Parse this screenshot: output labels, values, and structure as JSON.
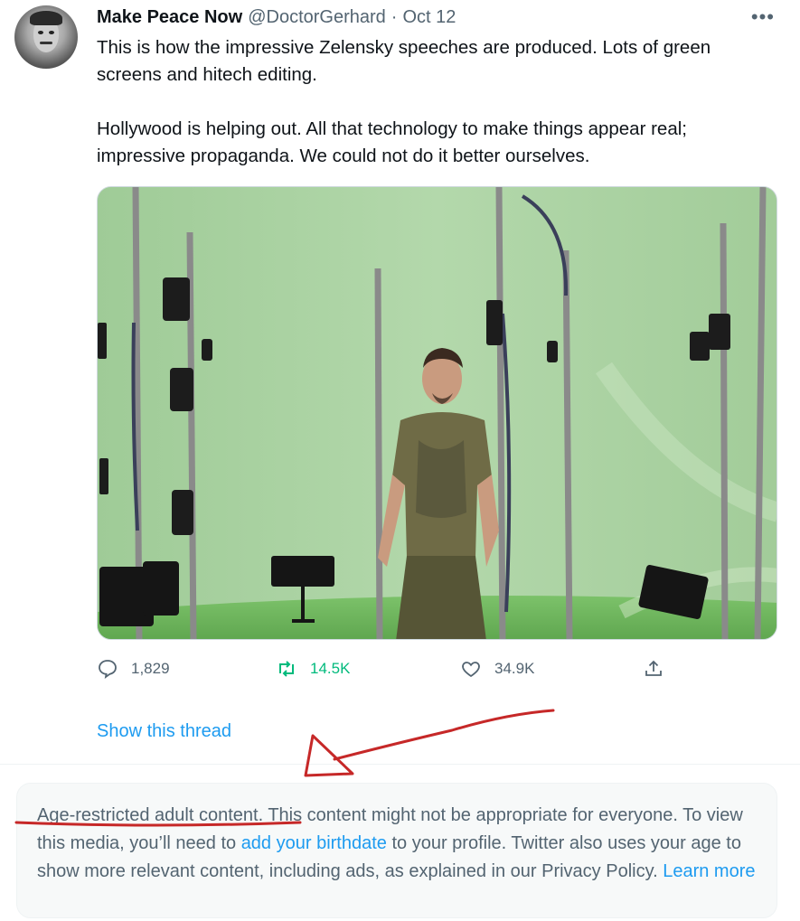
{
  "tweet": {
    "display_name": "Make Peace Now",
    "handle": "@DoctorGerhard",
    "separator": "·",
    "date": "Oct 12",
    "more_icon": "more-icon",
    "paragraph_1": "This is how the impressive Zelensky speeches are produced. Lots of green screens and hitech editing.",
    "paragraph_2": "Hollywood is helping out. All that technology to make things appear real; impressive propaganda. We could not do it better ourselves.",
    "actions": {
      "reply_count": "1,829",
      "retweet_count": "14.5K",
      "like_count": "34.9K"
    },
    "show_thread": "Show this thread"
  },
  "notice": {
    "label": "Age-restricted adult content.",
    "text_1": " This content might not be appropriate for everyone. To view this media, you’ll need to ",
    "link_birthdate": "add your birthdate",
    "text_2": " to your profile. Twitter also uses your age to show more relevant content, including ads, as explained in our Privacy Policy. ",
    "link_learn_more": "Learn more"
  },
  "colors": {
    "accent": "#1d9bf0",
    "retweet": "#00ba7c",
    "muted": "#536471",
    "annotation": "#c62828"
  }
}
